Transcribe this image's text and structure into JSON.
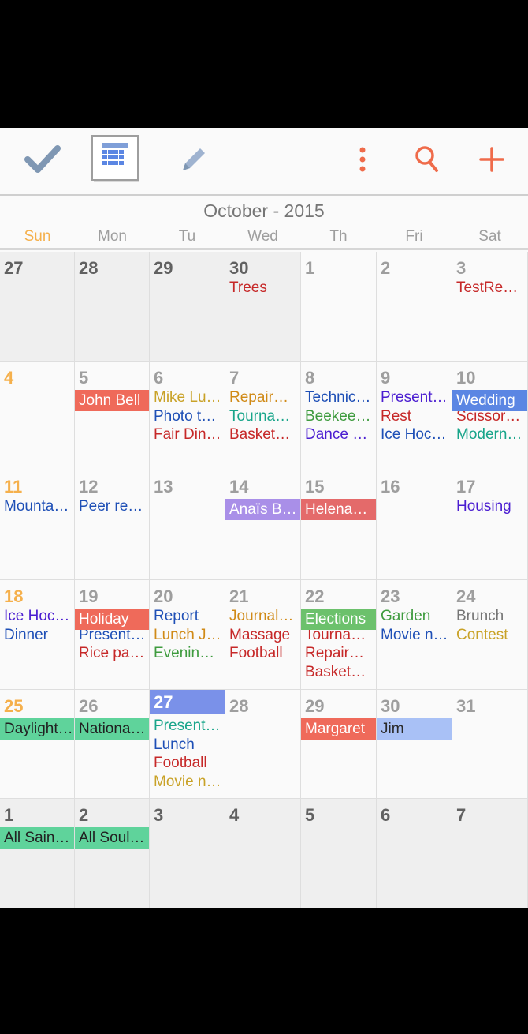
{
  "toolbar": {
    "icons": [
      "check-icon",
      "calendar-icon",
      "pencil-icon",
      "more-vert-icon",
      "search-icon",
      "add-icon"
    ],
    "icon_color_gray": "#7f97b3",
    "icon_color_accent": "#ef6b4a"
  },
  "month_title": "October - 2015",
  "days_of_week": [
    "Sun",
    "Mon",
    "Tu",
    "Wed",
    "Th",
    "Fri",
    "Sat"
  ],
  "colors": {
    "sunday": "#f5b04c",
    "today": "#7a91e9"
  },
  "weeks": [
    {
      "cells": [
        {
          "day": "27",
          "other_month": true,
          "events": []
        },
        {
          "day": "28",
          "other_month": true,
          "events": []
        },
        {
          "day": "29",
          "other_month": true,
          "events": []
        },
        {
          "day": "30",
          "other_month": true,
          "events": [
            {
              "text": "Trees",
              "color": "#c62828"
            }
          ]
        },
        {
          "day": "1",
          "events": []
        },
        {
          "day": "2",
          "events": []
        },
        {
          "day": "3",
          "events": [
            {
              "text": "TestRe…",
              "color": "#c62828"
            }
          ]
        }
      ],
      "bars": []
    },
    {
      "cells": [
        {
          "day": "4",
          "sunday": true,
          "events": []
        },
        {
          "day": "5",
          "events": []
        },
        {
          "day": "6",
          "events": [
            {
              "text": "Mike Lu…",
              "color": "#c9a227"
            },
            {
              "text": "Photo t…",
              "color": "#1e4fb6"
            },
            {
              "text": "Fair Din…",
              "color": "#c62828"
            }
          ]
        },
        {
          "day": "7",
          "events": [
            {
              "text": "Repair…",
              "color": "#d08a17"
            },
            {
              "text": "Tourna…",
              "color": "#18a58a"
            },
            {
              "text": "Basketb…",
              "color": "#c62828"
            }
          ]
        },
        {
          "day": "8",
          "events": [
            {
              "text": "Technic…",
              "color": "#1e4fb6"
            },
            {
              "text": "Beekee…",
              "color": "#3e9b3e"
            },
            {
              "text": "Dance e…",
              "color": "#4b1ed1"
            }
          ]
        },
        {
          "day": "9",
          "events": [
            {
              "text": "Present…",
              "color": "#4b1ed1"
            },
            {
              "text": "Rest",
              "color": "#c62828"
            },
            {
              "text": "Ice Hoc…",
              "color": "#1e4fb6"
            }
          ]
        },
        {
          "day": "10",
          "events": [
            {
              "text": "Scissor…",
              "color": "#c62828"
            },
            {
              "text": "Modern…",
              "color": "#18a58a"
            }
          ]
        }
      ],
      "bars": [
        {
          "text": "John Bell",
          "col": 1,
          "span": 1,
          "color": "#ef6a5a",
          "text_color": "#ffffff"
        },
        {
          "text": "Wedding",
          "col": 6,
          "span": 1,
          "color": "#5b86e3",
          "text_color": "#ffffff"
        }
      ]
    },
    {
      "cells": [
        {
          "day": "11",
          "sunday": true,
          "events": [
            {
              "text": "Mounta…",
              "color": "#1e4fb6"
            }
          ]
        },
        {
          "day": "12",
          "events": [
            {
              "text": "Peer re…",
              "color": "#1e4fb6"
            }
          ]
        },
        {
          "day": "13",
          "events": []
        },
        {
          "day": "14",
          "events": []
        },
        {
          "day": "15",
          "events": []
        },
        {
          "day": "16",
          "events": []
        },
        {
          "day": "17",
          "events": [
            {
              "text": "Housing",
              "color": "#4b1ed1"
            }
          ]
        }
      ],
      "bars": [
        {
          "text": "Anaïs B…",
          "col": 3,
          "span": 1,
          "color": "#a98fe8",
          "text_color": "#ffffff"
        },
        {
          "text": "Helena…",
          "col": 4,
          "span": 1,
          "color": "#e46a6a",
          "text_color": "#ffffff"
        }
      ]
    },
    {
      "cells": [
        {
          "day": "18",
          "sunday": true,
          "events": [
            {
              "text": "Ice Hoc…",
              "color": "#4b1ed1"
            },
            {
              "text": "Dinner",
              "color": "#1e4fb6"
            }
          ]
        },
        {
          "day": "19",
          "events": [
            {
              "text": "Present…",
              "color": "#1e4fb6"
            },
            {
              "text": "Rice pa…",
              "color": "#c62828"
            }
          ]
        },
        {
          "day": "20",
          "events": [
            {
              "text": "Report",
              "color": "#1e4fb6"
            },
            {
              "text": "Lunch J…",
              "color": "#d08a17"
            },
            {
              "text": "Evening…",
              "color": "#3e9b3e"
            }
          ]
        },
        {
          "day": "21",
          "events": [
            {
              "text": "Journal…",
              "color": "#d08a17"
            },
            {
              "text": "Massage",
              "color": "#c62828"
            },
            {
              "text": "Football",
              "color": "#c62828"
            }
          ]
        },
        {
          "day": "22",
          "events": [
            {
              "text": "Tourna…",
              "color": "#c62828"
            },
            {
              "text": "Repair…",
              "color": "#c62828"
            },
            {
              "text": "Basketb…",
              "color": "#c62828"
            }
          ]
        },
        {
          "day": "23",
          "events": [
            {
              "text": "Garden",
              "color": "#3e9b3e"
            },
            {
              "text": "Movie n…",
              "color": "#1e4fb6"
            }
          ]
        },
        {
          "day": "24",
          "events": [
            {
              "text": "Brunch",
              "color": "#757575"
            },
            {
              "text": "Contest",
              "color": "#c9a227"
            }
          ]
        }
      ],
      "bars": [
        {
          "text": "Holiday",
          "col": 1,
          "span": 1,
          "color": "#ef6a5a",
          "text_color": "#ffffff"
        },
        {
          "text": "Elections",
          "col": 4,
          "span": 1,
          "color": "#6cc16c",
          "text_color": "#ffffff"
        }
      ]
    },
    {
      "cells": [
        {
          "day": "25",
          "sunday": true,
          "events": []
        },
        {
          "day": "26",
          "events": []
        },
        {
          "day": "27",
          "today": true,
          "events": [
            {
              "text": "Present…",
              "color": "#18a58a"
            },
            {
              "text": "Lunch",
              "color": "#1e4fb6"
            },
            {
              "text": "Football",
              "color": "#c62828"
            },
            {
              "text": "Movie n…",
              "color": "#c9a227"
            }
          ]
        },
        {
          "day": "28",
          "events": []
        },
        {
          "day": "29",
          "events": []
        },
        {
          "day": "30",
          "events": []
        },
        {
          "day": "31",
          "events": []
        }
      ],
      "bars": [
        {
          "text": "Daylight…",
          "col": 0,
          "span": 1,
          "color": "#5fd39b",
          "text_color": "#212121"
        },
        {
          "text": "Nationa…",
          "col": 1,
          "span": 1,
          "color": "#5fd39b",
          "text_color": "#212121"
        },
        {
          "text": "Margaret",
          "col": 4,
          "span": 1,
          "color": "#ef6a5a",
          "text_color": "#ffffff"
        },
        {
          "text": "Jim",
          "col": 5,
          "span": 1,
          "color": "#a9c1f6",
          "text_color": "#2a2a2a"
        }
      ]
    },
    {
      "cells": [
        {
          "day": "1",
          "other_month": true,
          "events": []
        },
        {
          "day": "2",
          "other_month": true,
          "events": []
        },
        {
          "day": "3",
          "other_month": true,
          "events": []
        },
        {
          "day": "4",
          "other_month": true,
          "events": []
        },
        {
          "day": "5",
          "other_month": true,
          "events": []
        },
        {
          "day": "6",
          "other_month": true,
          "events": []
        },
        {
          "day": "7",
          "other_month": true,
          "events": []
        }
      ],
      "bars": [
        {
          "text": "All Sain…",
          "col": 0,
          "span": 1,
          "color": "#5fd39b",
          "text_color": "#212121"
        },
        {
          "text": "All Soul…",
          "col": 1,
          "span": 1,
          "color": "#5fd39b",
          "text_color": "#212121"
        }
      ]
    }
  ]
}
